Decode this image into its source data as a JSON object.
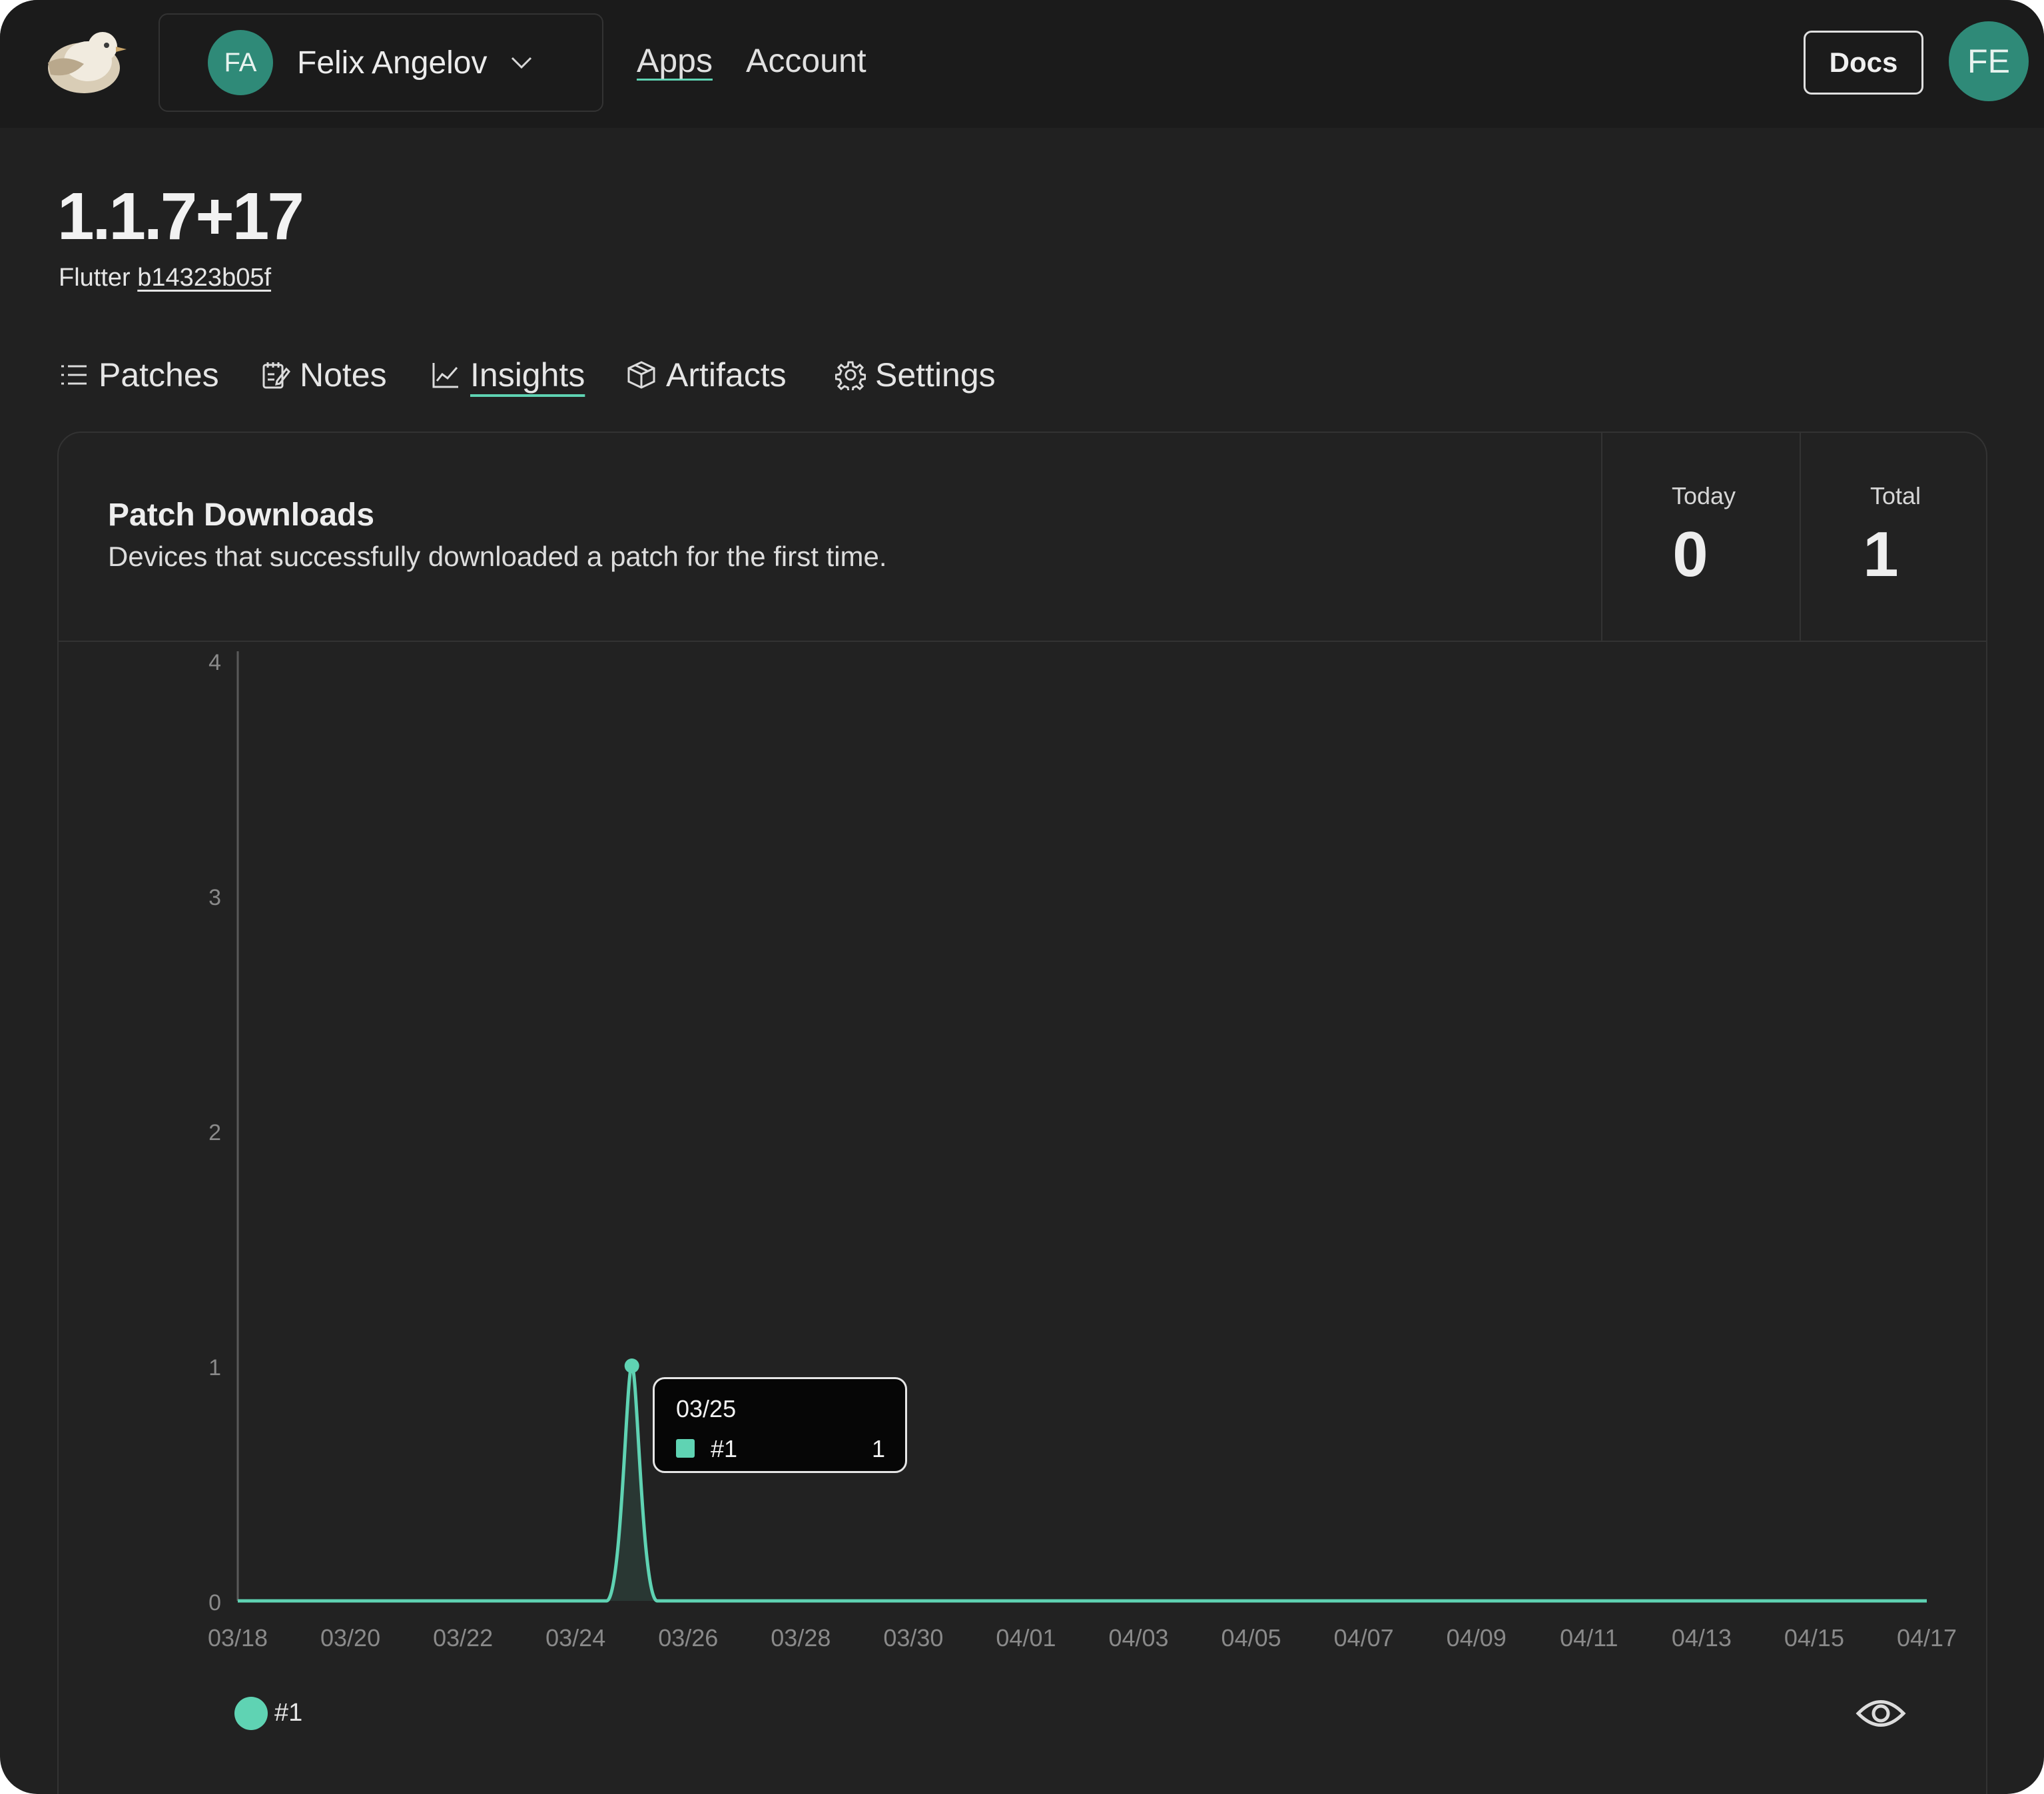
{
  "topbar": {
    "org": {
      "initials": "FA",
      "name": "Felix Angelov"
    },
    "nav": [
      {
        "label": "Apps",
        "active": true
      },
      {
        "label": "Account",
        "active": false
      }
    ],
    "docs_label": "Docs",
    "user_initials": "FE"
  },
  "release": {
    "version": "1.1.7+17",
    "flutter_label": "Flutter",
    "flutter_revision": "b14323b05f"
  },
  "tabs": [
    {
      "label": "Patches",
      "icon": "list-icon",
      "active": false
    },
    {
      "label": "Notes",
      "icon": "notes-icon",
      "active": false
    },
    {
      "label": "Insights",
      "icon": "line-chart-icon",
      "active": true
    },
    {
      "label": "Artifacts",
      "icon": "box-icon",
      "active": false
    },
    {
      "label": "Settings",
      "icon": "gear-icon",
      "active": false
    }
  ],
  "card": {
    "title": "Patch Downloads",
    "subtitle": "Devices that successfully downloaded a patch for the first time.",
    "stats": [
      {
        "label": "Today",
        "value": "0"
      },
      {
        "label": "Total",
        "value": "1"
      }
    ]
  },
  "chart_data": {
    "type": "area",
    "title": "",
    "xlabel": "",
    "ylabel": "",
    "ylim": [
      0,
      4
    ],
    "yticks": [
      "0",
      "1",
      "2",
      "3",
      "4"
    ],
    "x_tick_labels": [
      "03/18",
      "03/20",
      "03/22",
      "03/24",
      "03/26",
      "03/28",
      "03/30",
      "04/01",
      "04/03",
      "04/05",
      "04/07",
      "04/09",
      "04/11",
      "04/13",
      "04/15",
      "04/17"
    ],
    "x": [
      "03/18",
      "03/19",
      "03/20",
      "03/21",
      "03/22",
      "03/23",
      "03/24",
      "03/25",
      "03/26",
      "03/27",
      "03/28",
      "03/29",
      "03/30",
      "03/31",
      "04/01",
      "04/02",
      "04/03",
      "04/04",
      "04/05",
      "04/06",
      "04/07",
      "04/08",
      "04/09",
      "04/10",
      "04/11",
      "04/12",
      "04/13",
      "04/14",
      "04/15",
      "04/16",
      "04/17"
    ],
    "series": [
      {
        "name": "#1",
        "color": "#5fd3b3",
        "values": [
          0,
          0,
          0,
          0,
          0,
          0,
          0,
          1,
          0,
          0,
          0,
          0,
          0,
          0,
          0,
          0,
          0,
          0,
          0,
          0,
          0,
          0,
          0,
          0,
          0,
          0,
          0,
          0,
          0,
          0,
          0
        ]
      }
    ],
    "legend_position": "bottom-left",
    "grid": false,
    "tooltip": {
      "date": "03/25",
      "series": "#1",
      "value": "1"
    }
  },
  "colors": {
    "accent": "#5fd3b3",
    "avatar": "#2f8a78",
    "background": "#212121"
  }
}
